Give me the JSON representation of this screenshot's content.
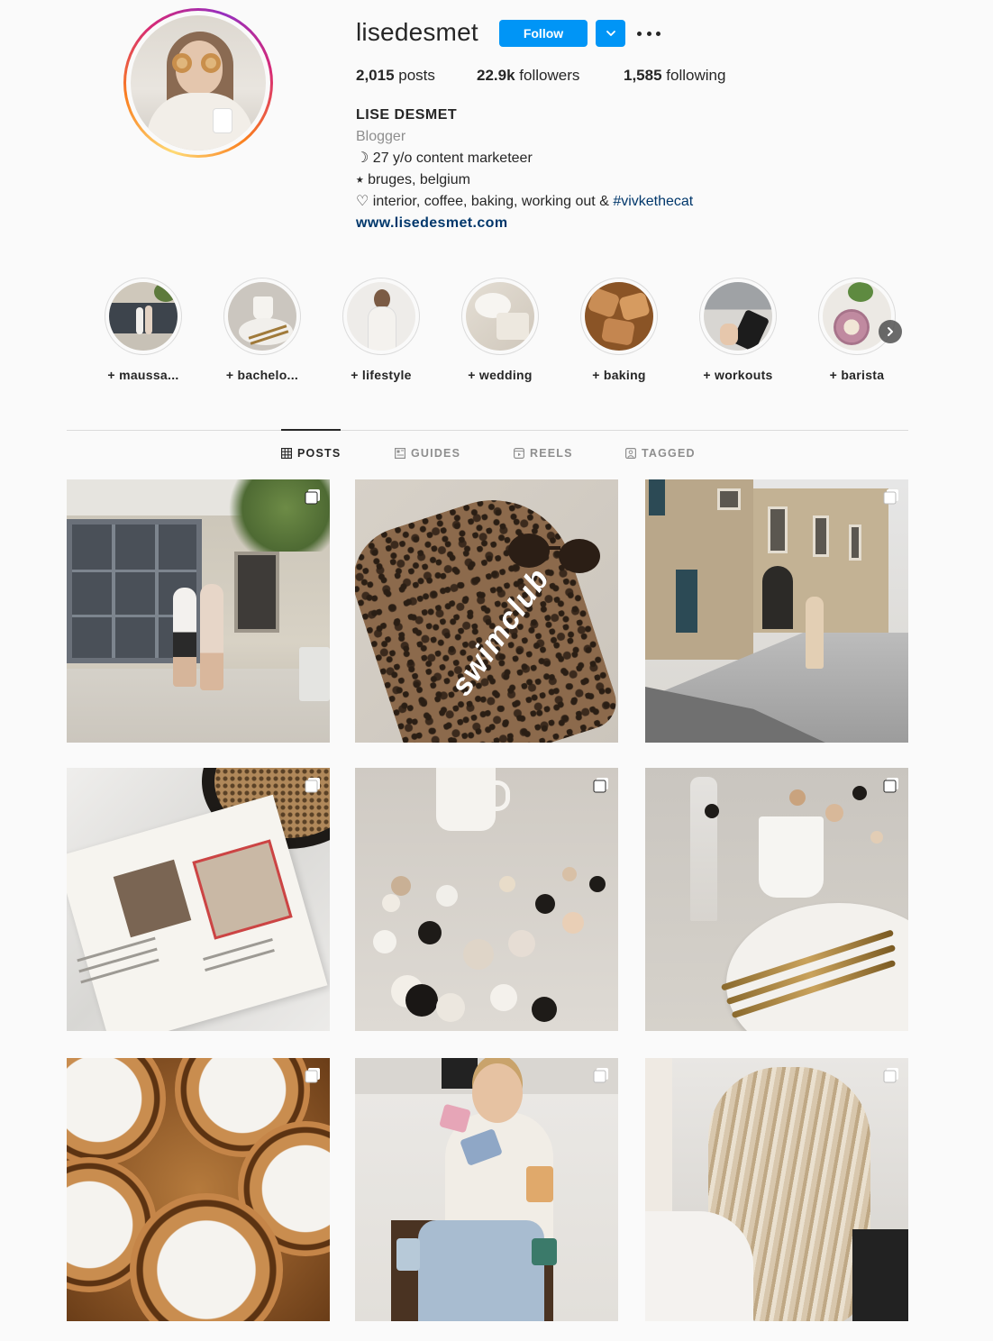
{
  "profile": {
    "username": "lisedesmet",
    "follow_label": "Follow",
    "stats": {
      "posts_value": "2,015",
      "posts_label": " posts",
      "followers_value": "22.9k",
      "followers_label": " followers",
      "following_value": "1,585",
      "following_label": " following"
    },
    "bio": {
      "name": "LISE DESMET",
      "category": "Blogger",
      "line1": "☽ 27 y/o content marketeer",
      "line2": "⭑ bruges, belgium",
      "line3_text": "♡ interior, coffee, baking, working out & ",
      "line3_hashtag": "#vivkethecat",
      "link": "www.lisedesmet.com"
    }
  },
  "highlights": [
    {
      "label": "+ maussa..."
    },
    {
      "label": "+ bachelo..."
    },
    {
      "label": "+ lifestyle"
    },
    {
      "label": "+ wedding"
    },
    {
      "label": "+ baking"
    },
    {
      "label": "+ workouts"
    },
    {
      "label": "+ barista"
    }
  ],
  "tabs": [
    {
      "label": "POSTS",
      "icon": "grid-icon",
      "active": true
    },
    {
      "label": "GUIDES",
      "icon": "guides-icon",
      "active": false
    },
    {
      "label": "REELS",
      "icon": "reels-icon",
      "active": false
    },
    {
      "label": "TAGGED",
      "icon": "tagged-icon",
      "active": false
    }
  ],
  "colors": {
    "accent": "#0095f6",
    "link": "#00376b",
    "text": "#262626",
    "secondary_text": "#8e8e8e",
    "background": "#fafafa"
  }
}
